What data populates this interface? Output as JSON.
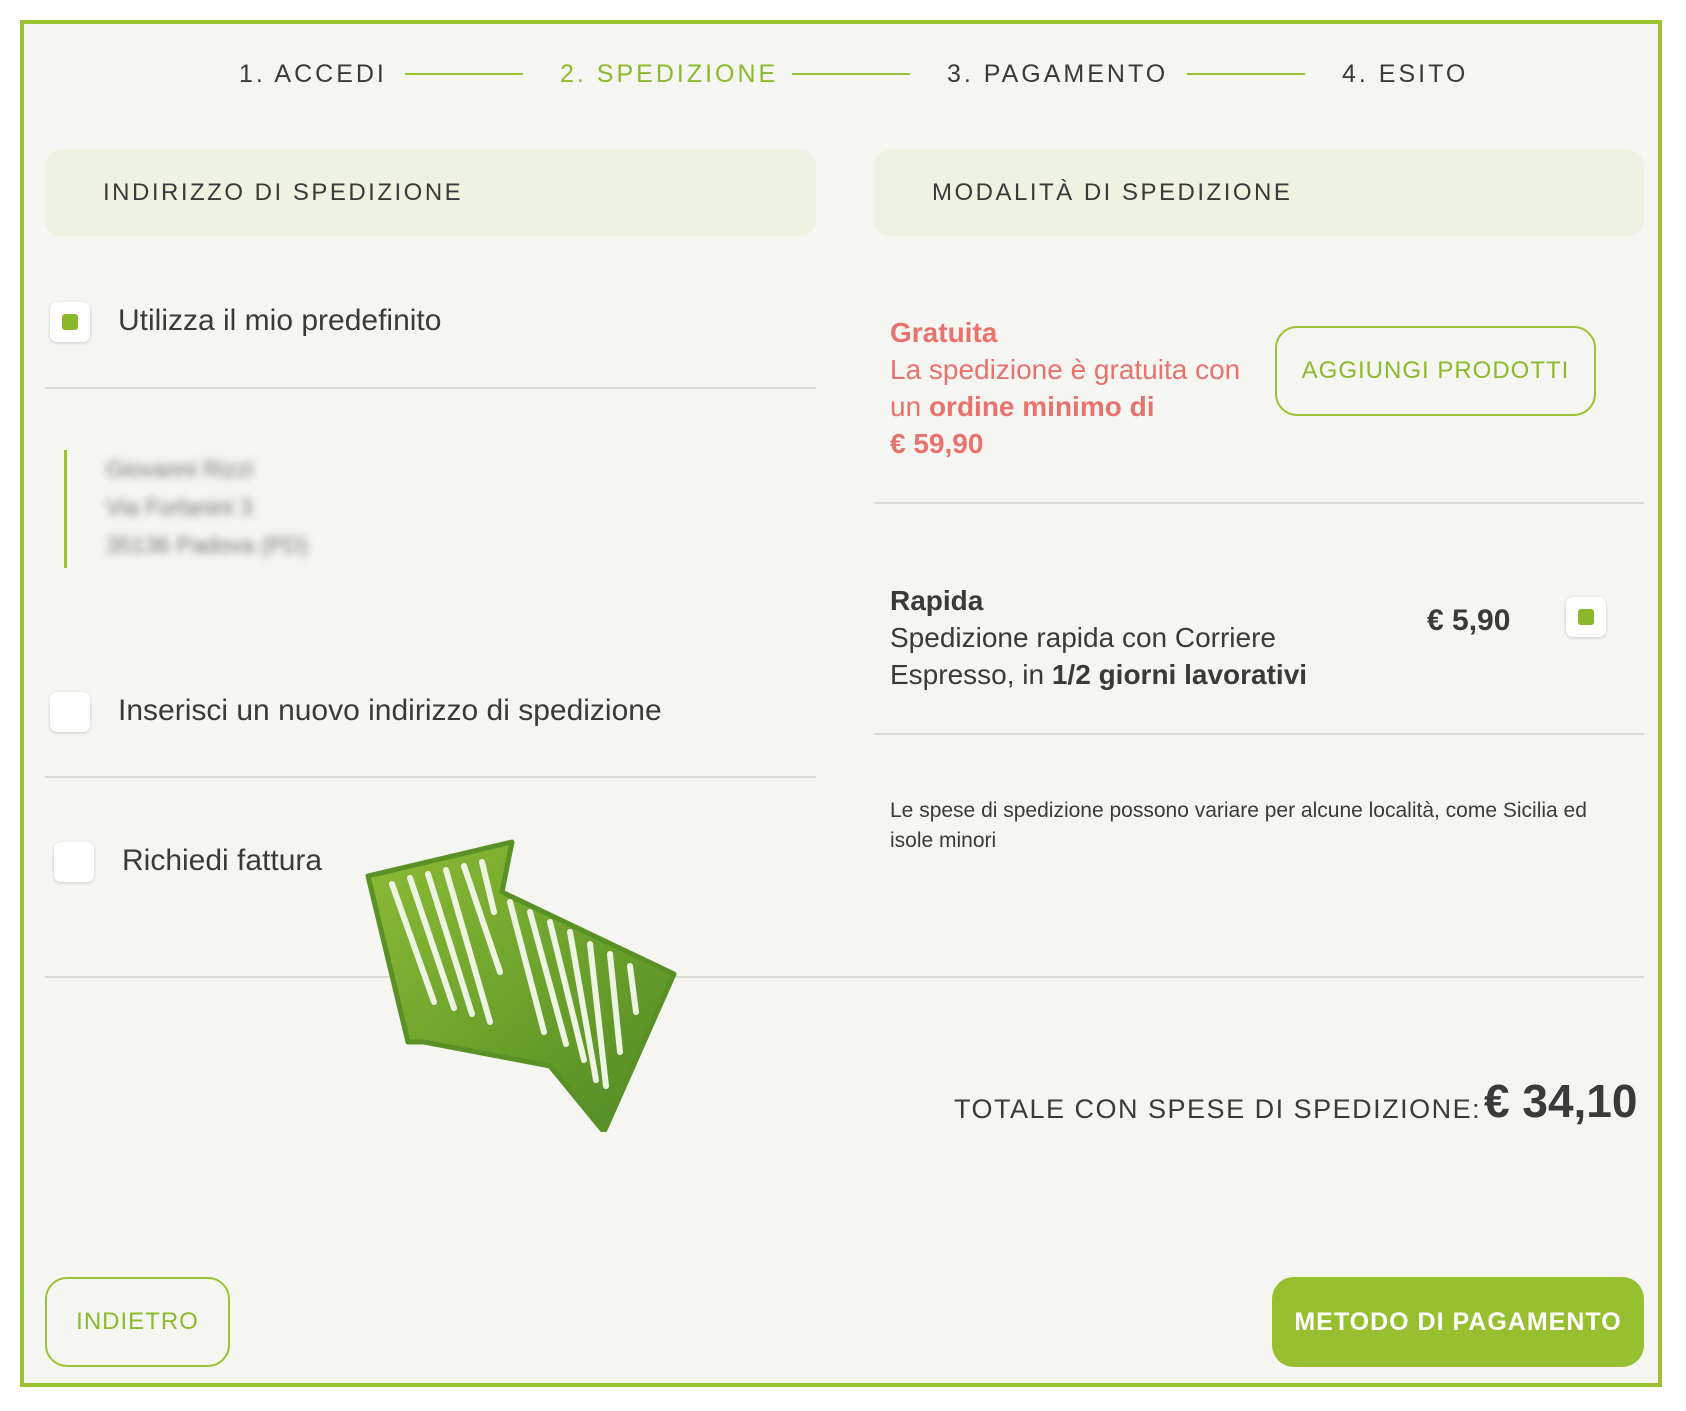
{
  "steps": [
    {
      "label": "1. ACCEDI"
    },
    {
      "label": "2. SPEDIZIONE"
    },
    {
      "label": "3. PAGAMENTO"
    },
    {
      "label": "4. ESITO"
    }
  ],
  "active_step": 2,
  "address_section": {
    "title": "INDIRIZZO DI SPEDIZIONE",
    "use_default_label": "Utilizza il mio predefinito",
    "use_default_checked": true,
    "address_lines": [
      "Giovanni Rizzi",
      "Via Forlanini 3",
      "35136 Padova (PD)"
    ],
    "new_address_label": "Inserisci un nuovo indirizzo di spedizione",
    "new_address_checked": false,
    "invoice_label": "Richiedi fattura",
    "invoice_checked": false
  },
  "shipping_section": {
    "title": "MODALITÀ DI SPEDIZIONE",
    "free": {
      "title": "Gratuita",
      "desc_prefix": "La spedizione è gratuita con un ",
      "desc_bold": "ordine minimo di",
      "min_amount": "€ 59,90",
      "button_label": "AGGIUNGI PRODOTTI"
    },
    "rapid": {
      "title": "Rapida",
      "desc_prefix": "Spedizione rapida con Corriere Espresso, in ",
      "desc_bold": "1/2 giorni lavorativi",
      "price": "€ 5,90",
      "checked": true
    },
    "note": "Le spese di spedizione possono variare per alcune località, come Sicilia ed isole minori"
  },
  "total": {
    "label": "TOTALE CON SPESE DI SPEDIZIONE:",
    "value": "€ 34,10"
  },
  "footer": {
    "back_label": "INDIETRO",
    "next_label": "METODO DI PAGAMENTO"
  },
  "colors": {
    "accent": "#9bc232",
    "free_shipping_red": "#e8726d",
    "arrow_green": "#6fa428"
  },
  "annotation": {
    "icon": "hand-drawn-arrow-icon"
  }
}
